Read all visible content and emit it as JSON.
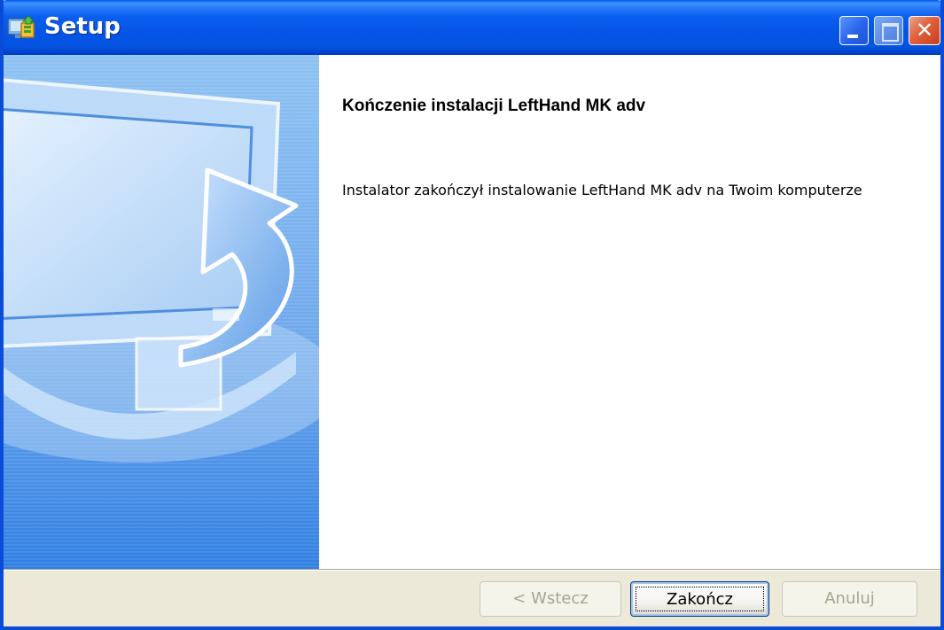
{
  "window": {
    "title": "Setup",
    "title_icon": "setup-installer-icon",
    "controls": {
      "minimize_icon": "minimize-icon",
      "maximize_icon": "maximize-icon",
      "close_icon": "close-icon",
      "close_glyph": "✕"
    },
    "colors": {
      "titlebar": "#0058ee",
      "close_button": "#e2603c",
      "dialog_face": "#ece9d8"
    }
  },
  "wizard": {
    "sidebar_image": "monitor-with-arrow-graphic",
    "heading": "Kończenie instalacji LeftHand MK adv",
    "message": "Instalator zakończył instalowanie LeftHand MK adv na Twoim komputerze"
  },
  "buttons": {
    "back_label": "< Wstecz",
    "finish_label": "Zakończ",
    "cancel_label": "Anuluj"
  }
}
